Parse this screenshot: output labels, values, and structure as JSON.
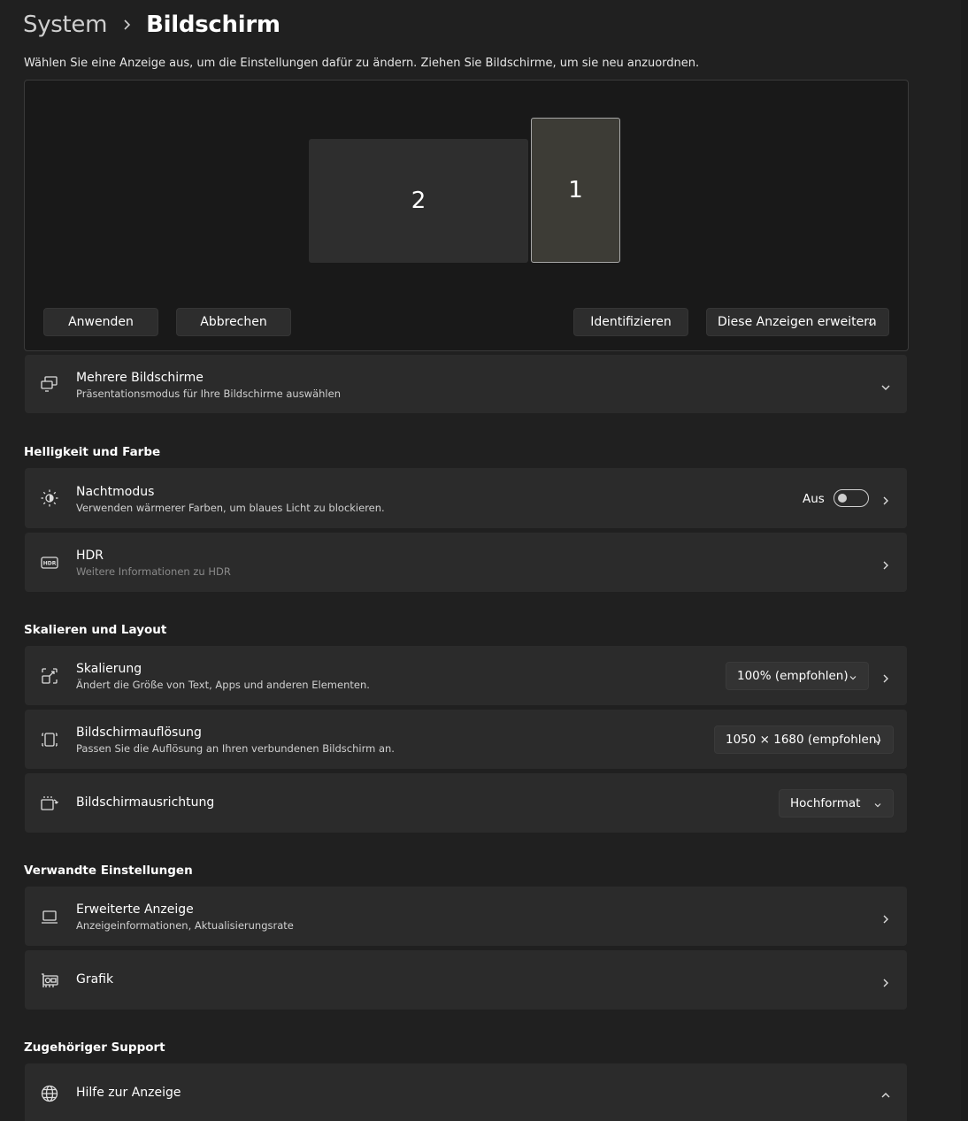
{
  "breadcrumb": {
    "parent": "System",
    "current": "Bildschirm"
  },
  "intro": "Wählen Sie eine Anzeige aus, um die Einstellungen dafür zu ändern. Ziehen Sie Bildschirme, um sie neu anzuordnen.",
  "arrangement": {
    "monitors": [
      {
        "label": "2"
      },
      {
        "label": "1",
        "selected": true
      }
    ],
    "apply_label": "Anwenden",
    "cancel_label": "Abbrechen",
    "identify_label": "Identifizieren",
    "mode_value": "Diese Anzeigen erweitern"
  },
  "multiple_displays": {
    "title": "Mehrere Bildschirme",
    "subtitle": "Präsentationsmodus für Ihre Bildschirme auswählen",
    "icon": "multiple-displays-icon"
  },
  "sections": {
    "brightness": "Helligkeit und Farbe",
    "scale_layout": "Skalieren und Layout",
    "related": "Verwandte Einstellungen",
    "support": "Zugehöriger Support"
  },
  "night_mode": {
    "title": "Nachtmodus",
    "subtitle": "Verwenden wärmerer Farben, um blaues Licht zu blockieren.",
    "state_label": "Aus",
    "on": false,
    "icon": "brightness-icon"
  },
  "hdr": {
    "title": "HDR",
    "subtitle": "Weitere Informationen zu HDR",
    "icon": "hdr-icon",
    "icon_text": "HDR"
  },
  "scale": {
    "title": "Skalierung",
    "subtitle": "Ändert die Größe von Text, Apps und anderen Elementen.",
    "value": "100% (empfohlen)",
    "icon": "scale-icon"
  },
  "resolution": {
    "title": "Bildschirmauflösung",
    "subtitle": "Passen Sie die Auflösung an Ihren verbundenen Bildschirm an.",
    "value": "1050 × 1680 (empfohlen)",
    "icon": "resolution-icon"
  },
  "orientation": {
    "title": "Bildschirmausrichtung",
    "value": "Hochformat",
    "icon": "orientation-icon"
  },
  "advanced_display": {
    "title": "Erweiterte Anzeige",
    "subtitle": "Anzeigeinformationen, Aktualisierungsrate",
    "icon": "laptop-icon"
  },
  "graphics": {
    "title": "Grafik",
    "icon": "graphics-card-icon"
  },
  "help_display": {
    "title": "Hilfe zur Anzeige",
    "icon": "globe-icon"
  },
  "colors": {
    "background": "#202020",
    "card": "#2b2b2b",
    "arrange_bg": "#191919",
    "selected_monitor": "#3d3c36"
  }
}
